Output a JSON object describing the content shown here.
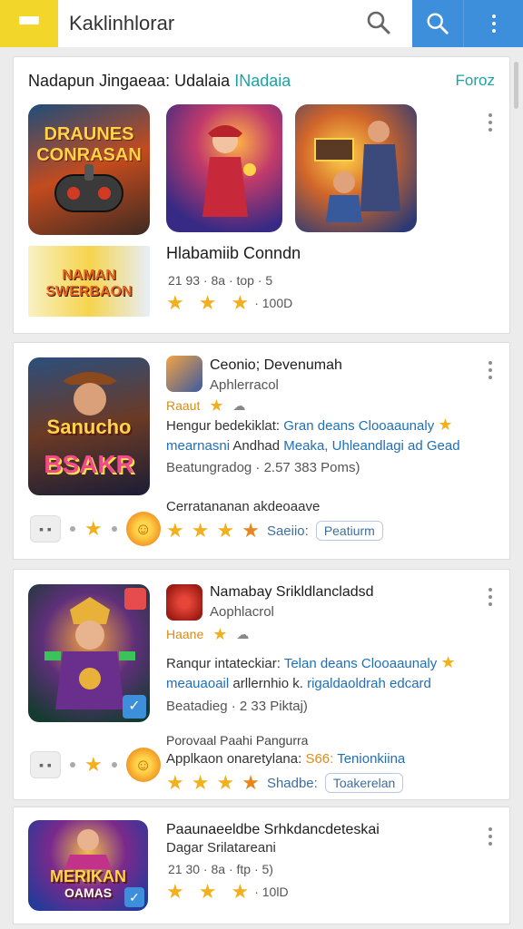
{
  "topbar": {
    "search_value": "Kaklinhlorar",
    "accent_yellow": "#f2d72a",
    "accent_blue": "#3d8fdc"
  },
  "featured": {
    "heading": "Nadapun Jingaeaa: Udalaia",
    "heading_accent": "INadaia",
    "more_link": "Foroz",
    "thumb1_text": "DRAUNES CONRASAN",
    "thumb4_text": "NAMAN SWERBAON",
    "app_title": "Hlabamiib Conndn",
    "meta": "21 93 · 8a · top · 5",
    "rating_count": "· 100D"
  },
  "app2": {
    "thumb_text_top": "Sanucho",
    "thumb_text_bottom": "BSAKR",
    "name": "Ceonio; Devenumah",
    "sub": "Aphlerracol",
    "badge": "Raaut",
    "line1_a": "Hengur bedekiklat:",
    "line1_b": "Gran deans Clooaaunaly",
    "line2_a": "mearnasni",
    "line2_b": "Andhad",
    "line2_c": "Meaka, Uhleandlagi ad Gead",
    "line3": "Beatungradog · 2.57 383 Poms)",
    "promo": "Cerratananan akdeoaave",
    "link": "Saeiio:",
    "pill": "Peatiurm"
  },
  "app3": {
    "name": "Namabay Srikldlancladsd",
    "sub": "Aophlacrol",
    "badge": "Haane",
    "line1_a": "Ranqur intateckiar:",
    "line1_b": "Telan deans Clooaaunaly",
    "line2_a": "meauaoail",
    "line2_b": "arllernhio k.",
    "line2_c": "rigaldaoldrah edcard",
    "line3": "Beatadieg · 2 33 Piktaj)",
    "promo1": "Porovaal Paahi Pangurra",
    "promo2_a": "Applkaon onaretylana:",
    "promo2_b": "S66:",
    "promo2_c": "Tenionkiina",
    "link": "Shadbe:",
    "pill": "Toakerelan"
  },
  "app4": {
    "thumb_text_top": "MERIKAN",
    "thumb_text_bottom": "OAMAS",
    "name": "Paaunaeeldbe Srhkdancdeteskai",
    "sub": "Dagar Srilatareani",
    "meta": "21 30 · 8a · ftp · 5)",
    "rating_count": "· 10lD"
  }
}
